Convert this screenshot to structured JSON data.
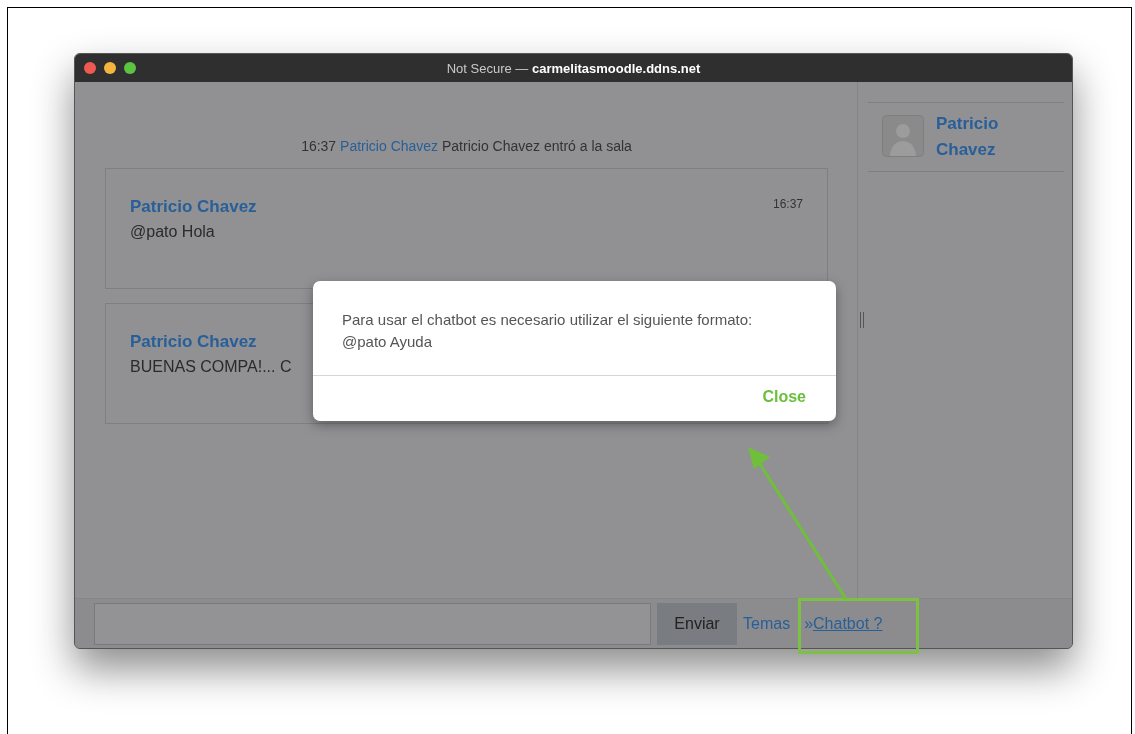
{
  "window": {
    "title_prefix": "Not Secure —",
    "title_host": "carmelitasmoodle.ddns.net"
  },
  "chat": {
    "system_message": {
      "time": "16:37",
      "user": "Patricio Chavez",
      "text": "Patricio Chavez entró a la sala"
    },
    "messages": [
      {
        "author": "Patricio Chavez",
        "time": "16:37",
        "text": "@pato Hola"
      },
      {
        "author": "Patricio Chavez",
        "text": "BUENAS COMPA!... C"
      }
    ]
  },
  "users": [
    {
      "name": "Patricio Chavez"
    }
  ],
  "composer": {
    "send": "Enviar",
    "topics_link": "Temas",
    "separator": "»",
    "chatbot_link": "Chatbot ?"
  },
  "dialog": {
    "lines": [
      "Para usar el chatbot es necesario utilizar el siguiente formato:",
      "@pato Ayuda"
    ],
    "close": "Close"
  }
}
